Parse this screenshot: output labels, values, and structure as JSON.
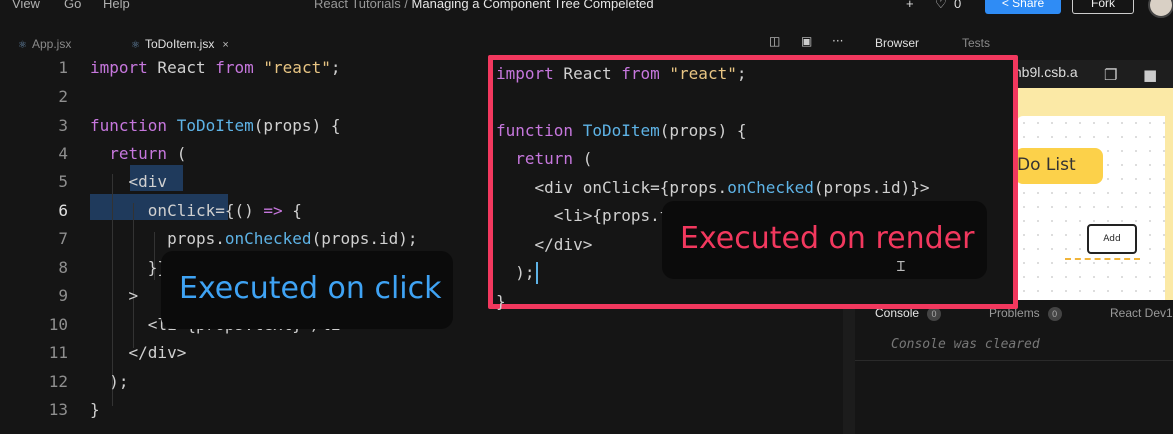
{
  "menu": [
    "View",
    "Go",
    "Help"
  ],
  "title": {
    "prefix": "React Tutorials / ",
    "name": "Managing a Component Tree Compeleted"
  },
  "topbar": {
    "plus": "+",
    "likes_icon": "heart-icon",
    "likes": "0",
    "share": "Share",
    "fork": "Fork"
  },
  "tabs": [
    {
      "label": "App.jsx",
      "active": false
    },
    {
      "label": "ToDoItem.jsx",
      "active": true,
      "close": "×"
    }
  ],
  "editor_tools": {
    "split": "split-icon",
    "preview": "preview-icon",
    "more": "···"
  },
  "right_tabs": [
    "Browser",
    "Tests"
  ],
  "line_numbers": [
    "1",
    "2",
    "3",
    "4",
    "5",
    "6",
    "7",
    "8",
    "9",
    "10",
    "11",
    "12",
    "13"
  ],
  "code_lines": [
    "import React from \"react\";",
    "",
    "function ToDoItem(props) {",
    "  return (",
    "    <div",
    "      onClick={() => {",
    "        props.onChecked(props.id);",
    "      }}",
    "    >",
    "      <li>{props.text}</li>",
    "    </div>",
    "  );",
    "}"
  ],
  "callout_lines": [
    "import React from \"react\";",
    "",
    "function ToDoItem(props) {",
    "  return (",
    "    <div onClick={props.onChecked(props.id)}>",
    "      <li>{props.text}</li>",
    "    </div>",
    "  );",
    "}"
  ],
  "browser": {
    "url": "mb9l.csb.a",
    "list_title": "Do List",
    "add_button": "Add"
  },
  "console_tabs": [
    {
      "label": "Console",
      "count": "0"
    },
    {
      "label": "Problems",
      "count": "0"
    },
    {
      "label": "React Dev1",
      "count": ""
    }
  ],
  "console_message": "Console was cleared",
  "annotations": {
    "on_click": "Executed on click",
    "on_render": "Executed on render"
  },
  "colors": {
    "accent_red": "#f2385e",
    "accent_blue": "#3fa3f4",
    "share_blue": "#2f8cf5"
  }
}
